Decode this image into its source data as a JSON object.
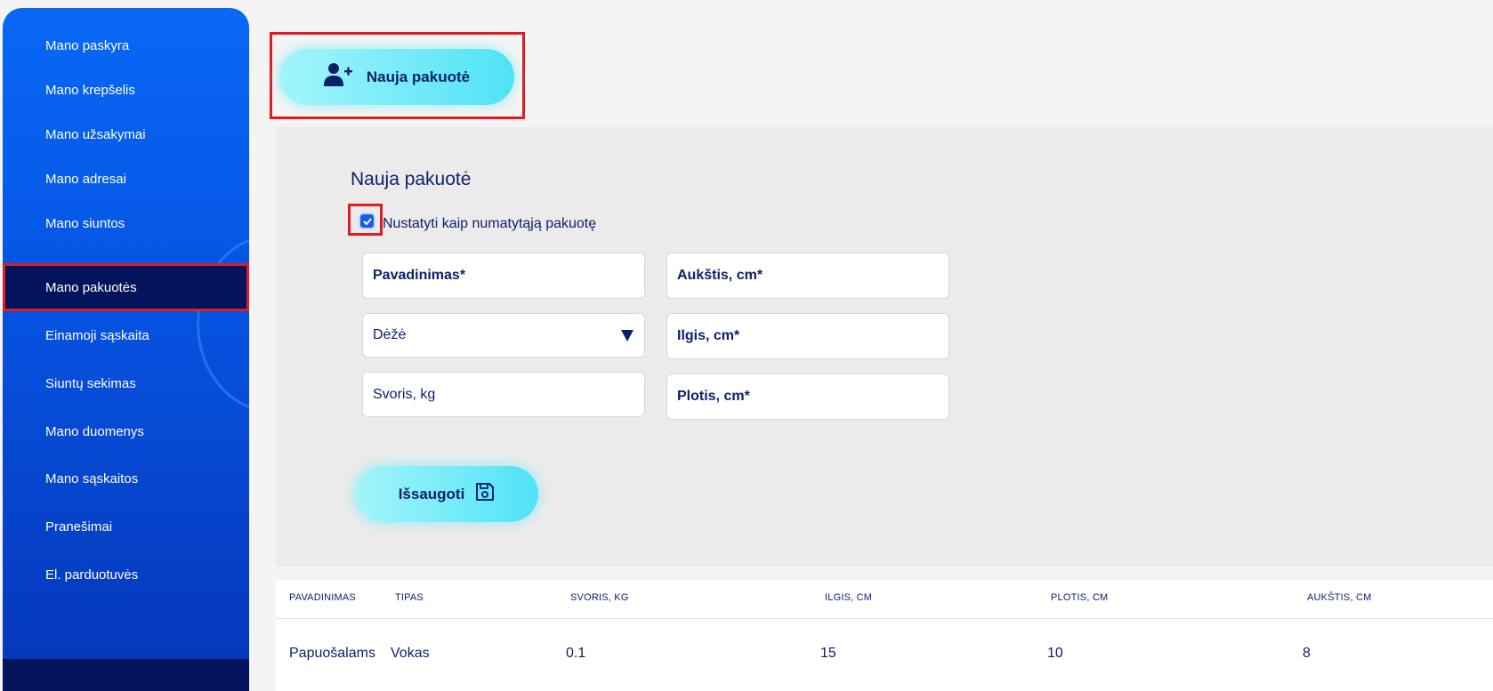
{
  "sidebar": {
    "items": [
      {
        "label": "Mano paskyra"
      },
      {
        "label": "Mano krepšelis"
      },
      {
        "label": "Mano užsakymai"
      },
      {
        "label": "Mano adresai"
      },
      {
        "label": "Mano siuntos"
      },
      {
        "label": "Mano pakuotės"
      },
      {
        "label": "Einamoji sąskaita"
      },
      {
        "label": "Siuntų sekimas"
      },
      {
        "label": "Mano duomenys"
      },
      {
        "label": "Mano sąskaitos"
      },
      {
        "label": "Pranešimai"
      },
      {
        "label": "El. parduotuvės"
      }
    ],
    "active_item": "Mano pakuotės"
  },
  "new_package_button": {
    "label": "Nauja pakuotė",
    "icon": "add-user-icon"
  },
  "form": {
    "title": "Nauja pakuotė",
    "default_checkbox": {
      "label": "Nustatyti kaip numatytąją pakuotę",
      "checked": true
    },
    "name_placeholder": "Pavadinimas*",
    "type_selected": "Dėžė",
    "weight_placeholder": "Svoris, kg",
    "height_placeholder": "Aukštis, cm*",
    "length_placeholder": "Ilgis, cm*",
    "width_placeholder": "Plotis, cm*",
    "save_label": "Išsaugoti",
    "save_icon": "floppy-disk-icon"
  },
  "table": {
    "headers": [
      "PAVADINIMAS",
      "TIPAS",
      "SVORIS, KG",
      "ILGIS, CM",
      "PLOTIS, CM",
      "AUKŠTIS, CM"
    ],
    "rows": [
      [
        "Papuošalams",
        "Vokas",
        "0.1",
        "15",
        "10",
        "8"
      ]
    ]
  },
  "colors": {
    "sidebar_top": "#0868f5",
    "sidebar_bottom": "#0536b8",
    "active_item_bg": "#04145c",
    "accent_cyan": "#4fe3f6",
    "text_navy": "#0b1f6b",
    "highlight_red": "#e01b24"
  }
}
